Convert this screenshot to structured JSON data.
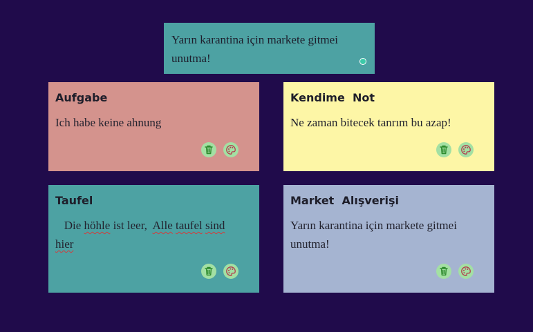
{
  "composer": {
    "text": "Yarın karantina için markete gitmei unutma!"
  },
  "notes": [
    {
      "title": "Aufgabe",
      "body": "Ich habe keine ahnung",
      "color": "#d4938d"
    },
    {
      "title": "Kendime  Not",
      "body": "Ne zaman bitecek tanrım bu azap!",
      "color": "#fdf6a6"
    },
    {
      "title": "Taufel",
      "body_parts": [
        "   Die ",
        "höhle",
        " ist leer,  ",
        "Alle",
        " ",
        "taufel",
        " ",
        "sind",
        "\n",
        "hier"
      ],
      "color": "#4da2a3"
    },
    {
      "title": "Market  Alışverişi",
      "body": "Yarın karantina için markete gitmei unutma!",
      "color": "#a5b4d1"
    }
  ],
  "icons": {
    "delete": "trash-icon",
    "color": "palette-icon"
  },
  "colors": {
    "background": "#200b4b",
    "icon_bg": "#a3e0a3",
    "trash_stroke": "#2e8b2e",
    "palette_stroke": "#b33b4e"
  }
}
